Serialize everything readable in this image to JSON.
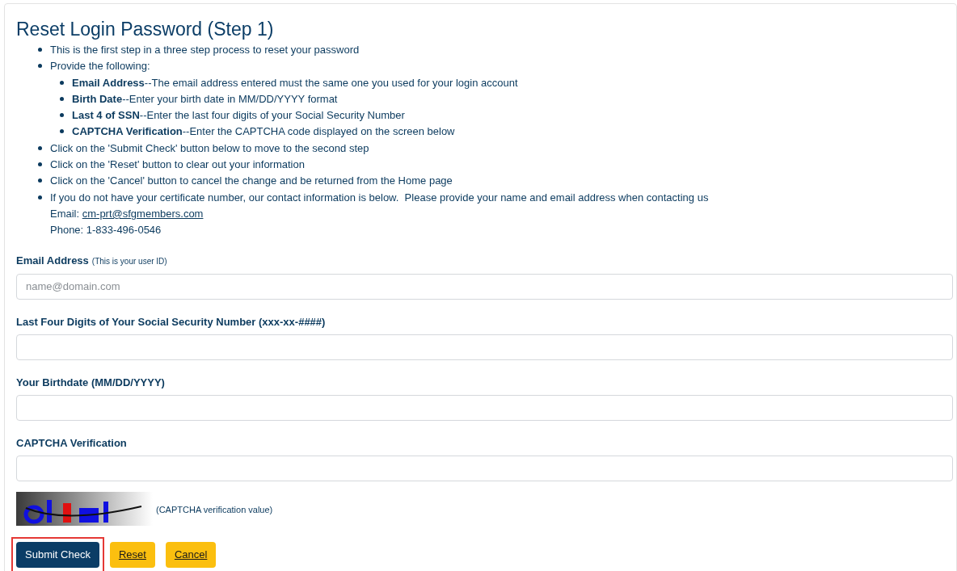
{
  "title": "Reset Login Password (Step 1)",
  "instructions": [
    {
      "text": "This is the first step in a three step process to reset your password"
    },
    {
      "text": "Provide the following:",
      "children": [
        {
          "text": "**Email Address**--The email address entered must the same one you used for your login account"
        },
        {
          "text": "**Birth Date**--Enter your birth date in MM/DD/YYYY format"
        },
        {
          "text": "**Last 4 of SSN**--Enter the last four digits of your Social Security Number"
        },
        {
          "text": "**CAPTCHA Verification**--Enter the CAPTCHA code displayed on the screen below"
        }
      ]
    },
    {
      "text": "Click on the 'Submit Check' button below to move to the second step"
    },
    {
      "text": "Click on the 'Reset' button to clear out your information"
    },
    {
      "text": "Click on the 'Cancel' button to cancel the change and be returned from the Home page"
    },
    {
      "text": "If you do not have your certificate number, our contact information is below.  Please provide your name and email address when contacting us",
      "email_label": "Email: ",
      "email": "cm-prt@sfgmembers.com",
      "phone": "Phone: 1-833-496-0546"
    }
  ],
  "fields": [
    {
      "label": "Email Address",
      "hint": "(This is your user ID)",
      "placeholder": "name@domain.com"
    },
    {
      "label": "Last Four Digits of Your Social Security Number (xxx-xx-####)"
    },
    {
      "label": "Your Birthdate (MM/DD/YYYY)"
    },
    {
      "label": "CAPTCHA Verification"
    }
  ],
  "captcha": {
    "kind": "picture",
    "caption": "(CAPTCHA verification value)"
  },
  "buttons": [
    {
      "label": "Submit Check",
      "kind": "primary",
      "highlighted": true
    },
    {
      "label": "Reset",
      "kind": "warning",
      "highlighted": false
    },
    {
      "label": "Cancel",
      "kind": "warning",
      "highlighted": false
    }
  ]
}
